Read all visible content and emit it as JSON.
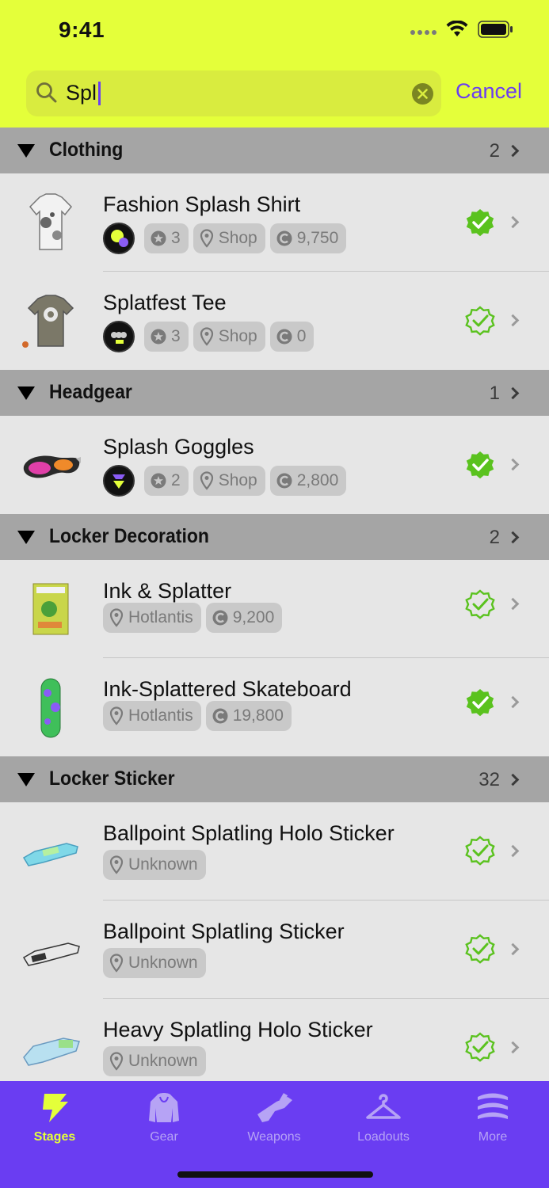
{
  "status": {
    "time": "9:41"
  },
  "search": {
    "query": "Spl",
    "cancel_label": "Cancel"
  },
  "colors": {
    "accent": "#6a3df2",
    "header": "#e4ff3a",
    "owned_check": "#5ac21e"
  },
  "sections": [
    {
      "title": "Clothing",
      "count": "2",
      "items": [
        {
          "name": "Fashion Splash Shirt",
          "stars": "3",
          "source": "Shop",
          "price": "9,750",
          "owned": true
        },
        {
          "name": "Splatfest Tee",
          "stars": "3",
          "source": "Shop",
          "price": "0",
          "owned": false
        }
      ]
    },
    {
      "title": "Headgear",
      "count": "1",
      "items": [
        {
          "name": "Splash Goggles",
          "stars": "2",
          "source": "Shop",
          "price": "2,800",
          "owned": true
        }
      ]
    },
    {
      "title": "Locker Decoration",
      "count": "2",
      "items": [
        {
          "name": "Ink & Splatter",
          "source": "Hotlantis",
          "price": "9,200",
          "owned": false
        },
        {
          "name": "Ink-Splattered Skateboard",
          "source": "Hotlantis",
          "price": "19,800",
          "owned": true
        }
      ]
    },
    {
      "title": "Locker Sticker",
      "count": "32",
      "items": [
        {
          "name": "Ballpoint Splatling Holo Sticker",
          "source": "Unknown",
          "owned": false
        },
        {
          "name": "Ballpoint Splatling Sticker",
          "source": "Unknown",
          "owned": false
        },
        {
          "name": "Heavy Splatling Holo Sticker",
          "source": "Unknown",
          "owned": false
        }
      ]
    }
  ],
  "tabs": [
    {
      "label": "Stages",
      "icon": "stages-icon",
      "active": true
    },
    {
      "label": "Gear",
      "icon": "gear-hoodie-icon",
      "active": false
    },
    {
      "label": "Weapons",
      "icon": "weapons-icon",
      "active": false
    },
    {
      "label": "Loadouts",
      "icon": "hanger-icon",
      "active": false
    },
    {
      "label": "More",
      "icon": "more-icon",
      "active": false
    }
  ]
}
